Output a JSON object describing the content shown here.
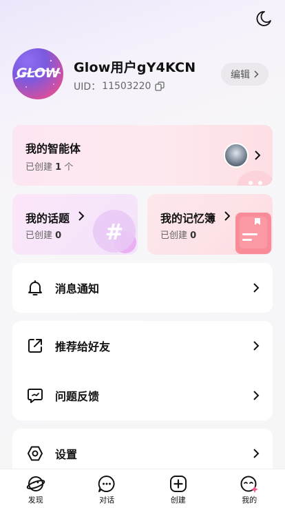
{
  "header": {
    "theme_toggle_icon": "moon-icon"
  },
  "profile": {
    "logo_text": "GLOW",
    "username": "Glow用户gY4KCN",
    "uid_label": "UID：",
    "uid_value": "11503220",
    "edit_label": "编辑"
  },
  "agent_card": {
    "title": "我的智能体",
    "sub_prefix": "已创建",
    "count": "1",
    "sub_suffix": "个"
  },
  "topic_card": {
    "title": "我的话题",
    "sub_prefix": "已创建",
    "count": "0"
  },
  "memo_card": {
    "title": "我的记忆簿",
    "sub_prefix": "已创建",
    "count": "0"
  },
  "menu": {
    "notifications": "消息通知",
    "recommend": "推荐给好友",
    "feedback": "问题反馈",
    "settings": "设置"
  },
  "tabbar": {
    "tabs": [
      {
        "label": "发现",
        "icon": "planet-icon"
      },
      {
        "label": "对话",
        "icon": "chat-bubble-icon"
      },
      {
        "label": "创建",
        "icon": "plus-square-icon"
      },
      {
        "label": "我的",
        "icon": "profile-face-icon"
      }
    ],
    "active_index": 3
  },
  "colors": {
    "accent_pink": "#f25a8c",
    "purple": "#7a5ae0",
    "text": "#111111"
  }
}
